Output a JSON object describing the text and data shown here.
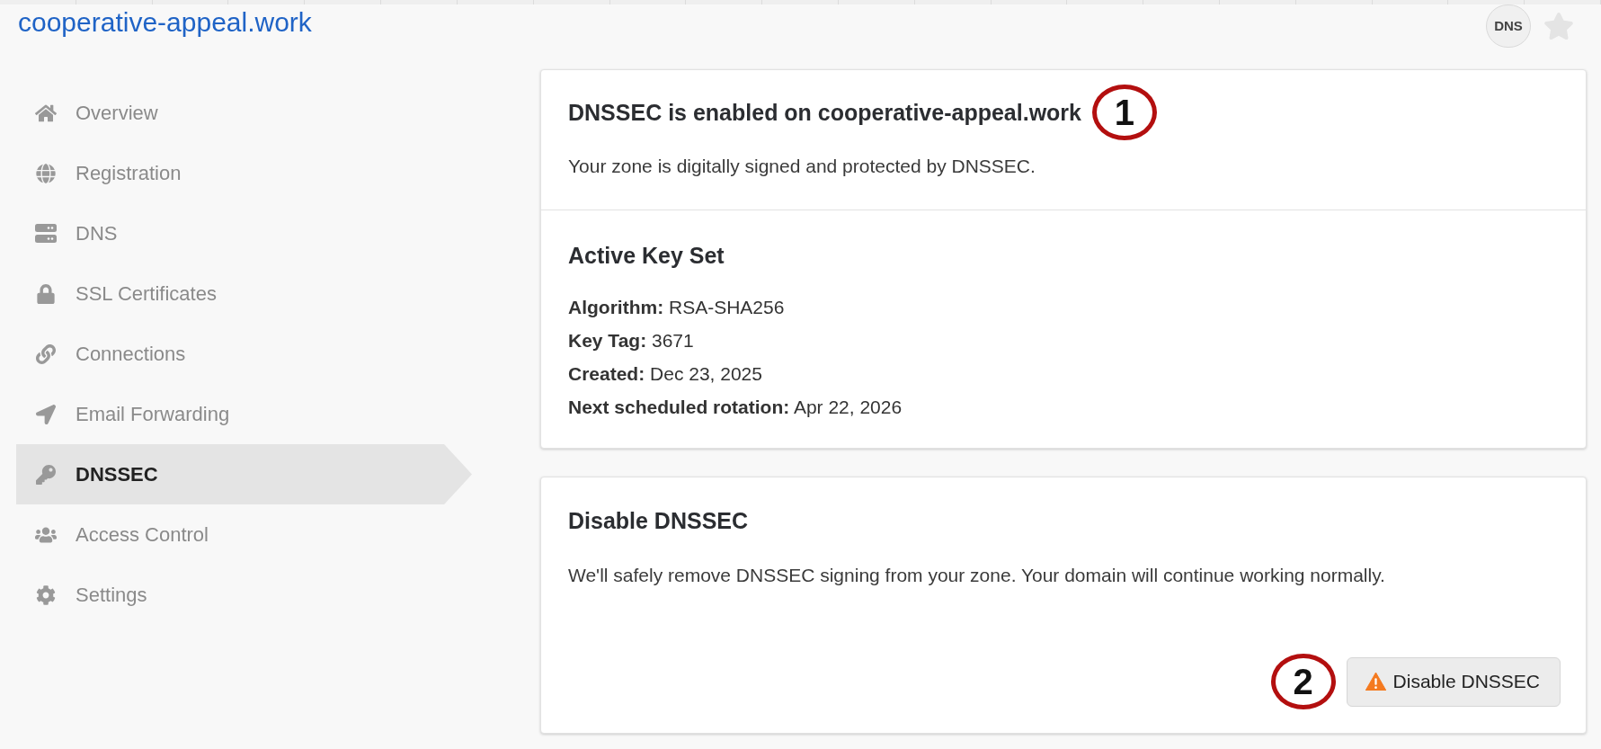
{
  "header": {
    "domain": "cooperative-appeal.work",
    "badge": "DNS",
    "starred": false
  },
  "sidebar": {
    "items": [
      {
        "label": "Overview",
        "selected": false
      },
      {
        "label": "Registration",
        "selected": false
      },
      {
        "label": "DNS",
        "selected": false
      },
      {
        "label": "SSL Certificates",
        "selected": false
      },
      {
        "label": "Connections",
        "selected": false
      },
      {
        "label": "Email Forwarding",
        "selected": false
      },
      {
        "label": "DNSSEC",
        "selected": true
      },
      {
        "label": "Access Control",
        "selected": false
      },
      {
        "label": "Settings",
        "selected": false
      }
    ]
  },
  "status_card": {
    "title": "DNSSEC is enabled on cooperative-appeal.work",
    "callout": "1",
    "text": "Your zone is digitally signed and protected by DNSSEC.",
    "key_set": {
      "title": "Active Key Set",
      "fields": [
        "**Algorithm:** RSA-SHA256",
        "**Key Tag:** 3671",
        "**Created:** Dec 23, 2025",
        "**Next scheduled rotation:** Apr 22, 2026"
      ]
    }
  },
  "disable_card": {
    "title": "Disable DNSSEC",
    "text": "We'll safely remove DNSSEC signing from your zone. Your domain will continue working normally.",
    "callout": "2",
    "button": {
      "label": "Disable DNSSEC"
    }
  }
}
